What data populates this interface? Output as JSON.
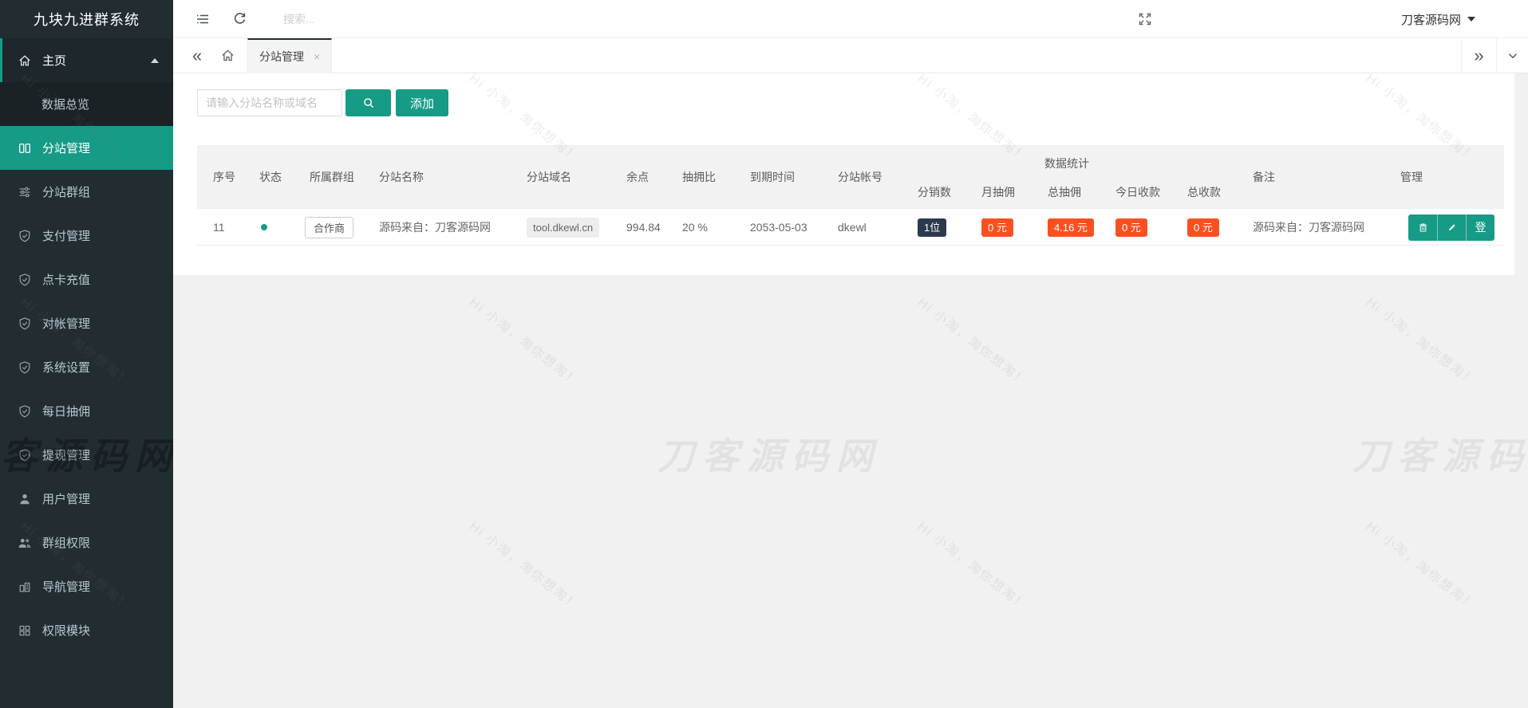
{
  "app": {
    "sidebar_title": "九块九进群系统"
  },
  "topbar": {
    "search_placeholder": "搜索...",
    "username": "刀客源码网"
  },
  "tabbar": {
    "back_glyph": "«",
    "forward_glyph": "»",
    "tab_label": "分站管理",
    "close_glyph": "×"
  },
  "toolbar": {
    "search_placeholder": "请输入分站名称或域名",
    "add_label": "添加"
  },
  "sidebar": {
    "menu": [
      {
        "label": "主页"
      },
      {
        "label": "数据总览"
      },
      {
        "label": "分站管理"
      },
      {
        "label": "分站群组"
      },
      {
        "label": "支付管理"
      },
      {
        "label": "点卡充值"
      },
      {
        "label": "对帐管理"
      },
      {
        "label": "系统设置"
      },
      {
        "label": "每日抽佣"
      },
      {
        "label": "提现管理"
      },
      {
        "label": "用户管理"
      },
      {
        "label": "群组权限"
      },
      {
        "label": "导航管理"
      },
      {
        "label": "权限模块"
      }
    ]
  },
  "table": {
    "headers": {
      "index": "序号",
      "status": "状态",
      "group": "所属群组",
      "site_name": "分站名称",
      "domain": "分站域名",
      "balance": "余点",
      "rate": "抽拥比",
      "expire": "到期时间",
      "account": "分站帐号",
      "stats_group": "数据统计",
      "distributors": "分销数",
      "month_comm": "月抽佣",
      "total_comm": "总抽佣",
      "today_income": "今日收款",
      "total_income": "总收款",
      "remark": "备注",
      "manage": "管理"
    },
    "row": {
      "index": "11",
      "group_tag": "合作商",
      "site_name": "源码来自：刀客源码网",
      "domain": "tool.dkewl.cn",
      "balance": "994.84",
      "rate": "20 %",
      "expire": "2053-05-03",
      "account": "dkewl",
      "distributors": "1位",
      "month_comm": "0 元",
      "total_comm": "4.16 元",
      "today_income": "0 元",
      "total_income": "0 元",
      "remark": "源码来自：刀客源码网",
      "login_label": "登"
    }
  },
  "watermark": {
    "small": "Hi 小淘，淘你想淘！",
    "large": "刀客源码网"
  },
  "colors": {
    "accent": "#169b87",
    "sidebar_bg": "#222d32",
    "badge_orange": "#fa5020",
    "badge_dark": "#2b3a4d",
    "status_dot": "#169b87"
  }
}
